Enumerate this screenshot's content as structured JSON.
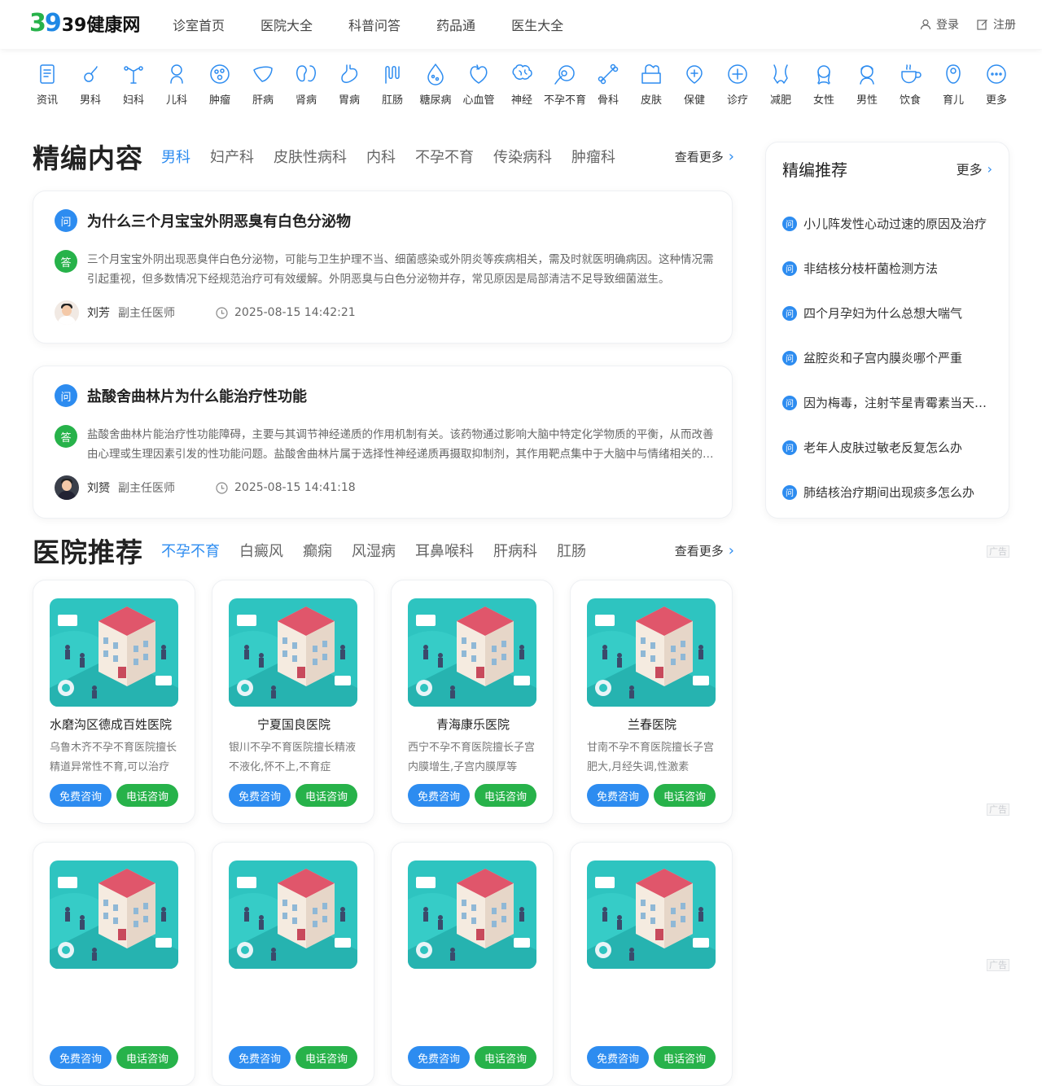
{
  "header": {
    "logo_mark_a": "3",
    "logo_mark_b": "9",
    "logo_text": "39健康网",
    "nav": [
      "诊室首页",
      "医院大全",
      "科普问答",
      "药品通",
      "医生大全"
    ],
    "login": "登录",
    "register": "注册"
  },
  "categories": [
    {
      "label": "资讯",
      "icon": "news-icon"
    },
    {
      "label": "男科",
      "icon": "male-organ-icon"
    },
    {
      "label": "妇科",
      "icon": "uterus-icon"
    },
    {
      "label": "儿科",
      "icon": "baby-icon"
    },
    {
      "label": "肿瘤",
      "icon": "tumor-icon"
    },
    {
      "label": "肝病",
      "icon": "liver-icon"
    },
    {
      "label": "肾病",
      "icon": "kidney-icon"
    },
    {
      "label": "胃病",
      "icon": "stomach-icon"
    },
    {
      "label": "肛肠",
      "icon": "intestine-icon"
    },
    {
      "label": "糖尿病",
      "icon": "blood-drop-icon"
    },
    {
      "label": "心血管",
      "icon": "heart-icon"
    },
    {
      "label": "神经",
      "icon": "brain-icon"
    },
    {
      "label": "不孕不育",
      "icon": "sperm-egg-icon"
    },
    {
      "label": "骨科",
      "icon": "bone-icon"
    },
    {
      "label": "皮肤",
      "icon": "skin-icon"
    },
    {
      "label": "保健",
      "icon": "health-care-icon"
    },
    {
      "label": "诊疗",
      "icon": "medical-plus-icon"
    },
    {
      "label": "减肥",
      "icon": "waist-icon"
    },
    {
      "label": "女性",
      "icon": "woman-icon"
    },
    {
      "label": "男性",
      "icon": "man-icon"
    },
    {
      "label": "饮食",
      "icon": "cup-icon"
    },
    {
      "label": "育儿",
      "icon": "infant-icon"
    },
    {
      "label": "更多",
      "icon": "more-icon"
    }
  ],
  "featured": {
    "title": "精编内容",
    "tabs": [
      "男科",
      "妇产科",
      "皮肤性病科",
      "内科",
      "不孕不育",
      "传染病科",
      "肿瘤科"
    ],
    "active_tab": "男科",
    "more": "查看更多",
    "q_badge": "问",
    "a_badge": "答",
    "items": [
      {
        "question": "为什么三个月宝宝外阴恶臭有白色分泌物",
        "answer": "三个月宝宝外阴出现恶臭伴白色分泌物，可能与卫生护理不当、细菌感染或外阴炎等疾病相关，需及时就医明确病因。这种情况需引起重视，但多数情况下经规范治疗可有效缓解。外阴恶臭与白色分泌物并存，常见原因是局部清洁不足导致细菌滋生。",
        "doctor": "刘芳",
        "doctor_title": "副主任医师",
        "time": "2025-08-15 14:42:21"
      },
      {
        "question": "盐酸舍曲林片为什么能治疗性功能",
        "answer": "盐酸舍曲林片能治疗性功能障碍，主要与其调节神经递质的作用机制有关。该药物通过影响大脑中特定化学物质的平衡，从而改善由心理或生理因素引发的性功能问题。盐酸舍曲林片属于选择性神经递质再摄取抑制剂，其作用靶点集中于大脑中与情绪相关的区域。",
        "doctor": "刘赟",
        "doctor_title": "副主任医师",
        "time": "2025-08-15 14:41:18"
      }
    ]
  },
  "recommend": {
    "title": "精编推荐",
    "more": "更多",
    "badge": "问",
    "items": [
      "小儿阵发性心动过速的原因及治疗",
      "非结核分枝杆菌检测方法",
      "四个月孕妇为什么总想大喘气",
      "盆腔炎和子宫内膜炎哪个严重",
      "因为梅毒，注射苄星青霉素当天能同房吗",
      "老年人皮肤过敏老反复怎么办",
      "肺结核治疗期间出现痰多怎么办"
    ]
  },
  "ad_label": "广告",
  "hospitals": {
    "title": "医院推荐",
    "tabs": [
      "不孕不育",
      "白癜风",
      "癫痫",
      "风湿病",
      "耳鼻喉科",
      "肝病科",
      "肛肠"
    ],
    "active_tab": "不孕不育",
    "more": "查看更多",
    "btn_free": "免费咨询",
    "btn_phone": "电话咨询",
    "items": [
      {
        "name": "水磨沟区德成百姓医院",
        "desc": "乌鲁木齐不孕不育医院擅长精道异常性不育,可以治疗"
      },
      {
        "name": "宁夏国良医院",
        "desc": "银川不孕不育医院擅长精液不液化,怀不上,不育症"
      },
      {
        "name": "青海康乐医院",
        "desc": "西宁不孕不育医院擅长子宫内膜增生,子宫内膜厚等"
      },
      {
        "name": "兰春医院",
        "desc": "甘南不孕不育医院擅长子宫肥大,月经失调,性激素"
      },
      {
        "name": "",
        "desc": ""
      },
      {
        "name": "",
        "desc": ""
      },
      {
        "name": "",
        "desc": ""
      },
      {
        "name": "",
        "desc": ""
      }
    ]
  },
  "colors": {
    "accent": "#2d8cf0",
    "green": "#27b24a"
  }
}
